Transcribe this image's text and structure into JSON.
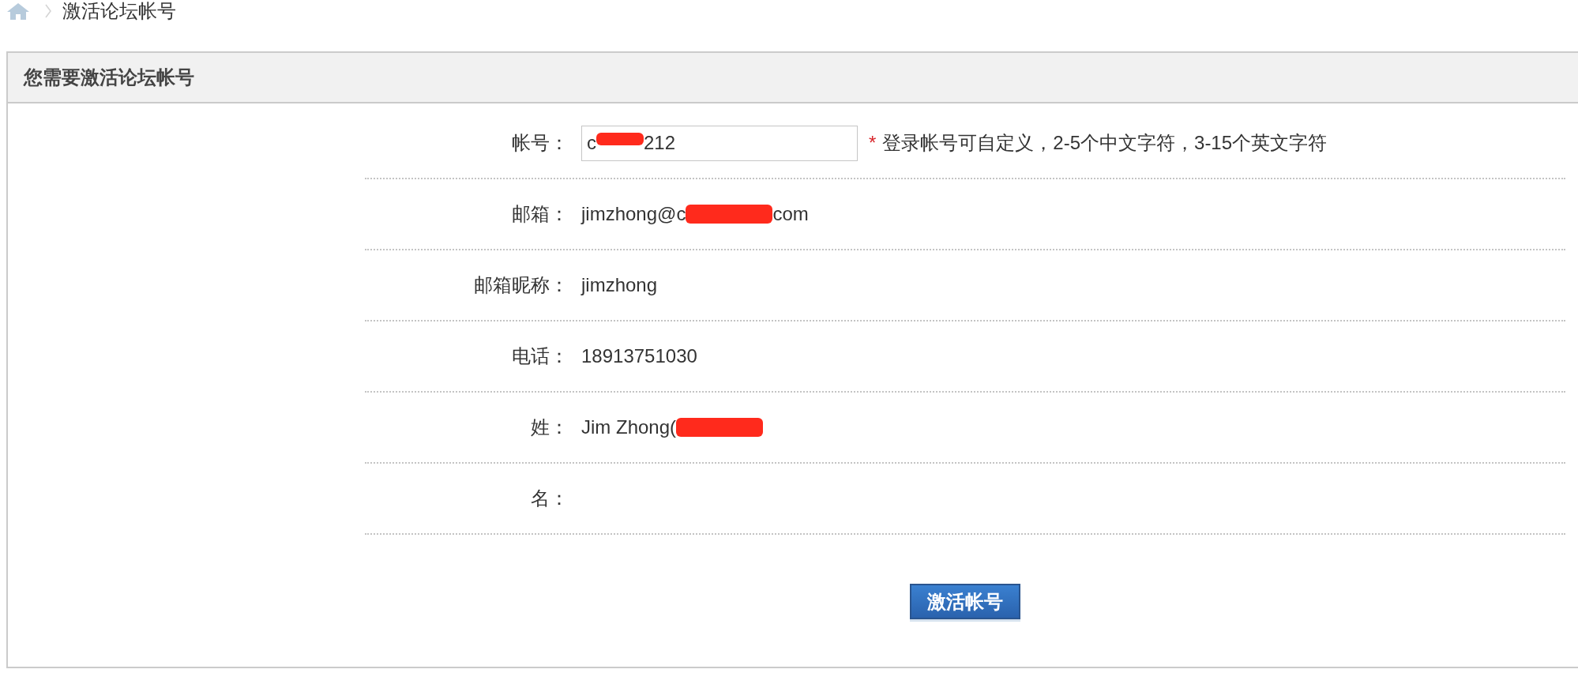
{
  "breadcrumb": {
    "current": "激活论坛帐号"
  },
  "panel": {
    "title": "您需要激活论坛帐号"
  },
  "form": {
    "fields": [
      {
        "kind": "input",
        "label": "帐号：",
        "value": [
          {
            "kind": "text",
            "text": "c"
          },
          {
            "kind": "redaction"
          },
          {
            "kind": "text",
            "text": "212"
          }
        ],
        "required_mark": "*",
        "hint": "登录帐号可自定义，2-5个中文字符，3-15个英文字符"
      },
      {
        "kind": "text",
        "label": "邮箱：",
        "value": [
          {
            "kind": "text",
            "text": "jimzhong@c"
          },
          {
            "kind": "redaction"
          },
          {
            "kind": "text",
            "text": "com"
          }
        ]
      },
      {
        "kind": "text",
        "label": "邮箱昵称：",
        "value": [
          {
            "kind": "text",
            "text": "jimzhong"
          }
        ]
      },
      {
        "kind": "text",
        "label": "电话：",
        "value": [
          {
            "kind": "text",
            "text": "18913751030"
          }
        ]
      },
      {
        "kind": "text",
        "label": "姓：",
        "value": [
          {
            "kind": "text",
            "text": "Jim Zhong("
          },
          {
            "kind": "redaction"
          }
        ]
      },
      {
        "kind": "text",
        "label": "名："
      }
    ]
  },
  "submit_button": "激活帐号"
}
